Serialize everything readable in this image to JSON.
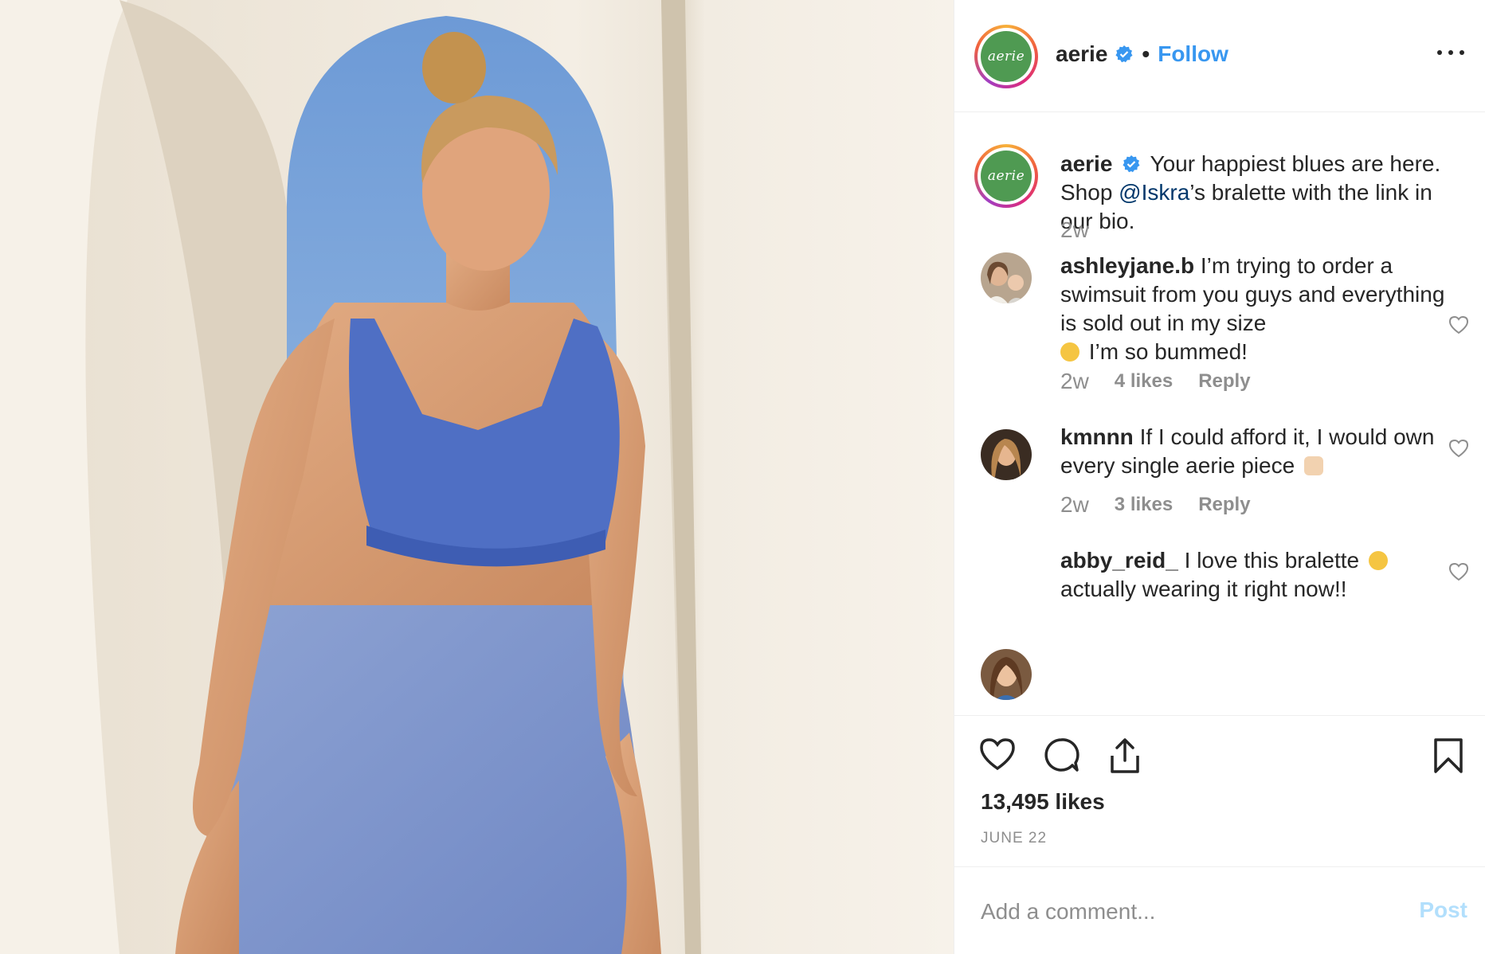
{
  "post": {
    "username": "aerie",
    "logo_text": "aerie",
    "follow_label": "Follow",
    "separator": "•",
    "caption": {
      "username": "aerie",
      "text_before": "Your happiest blues are here. Shop ",
      "mention": "@Iskra",
      "text_after": "’s bralette with the link in our bio.",
      "time": "2w"
    },
    "comments": [
      {
        "username": "ashleyjane.b",
        "text": "I’m trying to order a swimsuit from you guys and everything is sold out in my size",
        "text_end": "I’m so bummed!",
        "time": "2w",
        "likes": "4 likes",
        "reply": "Reply",
        "emoji": "crying-face"
      },
      {
        "username": "kmnnn",
        "text": "If I could afford it, I would own every single aerie piece",
        "time": "2w",
        "likes": "3 likes",
        "reply": "Reply",
        "emoji": "raised-hands"
      },
      {
        "username": "abby_reid_",
        "text": "I love this bralette",
        "text_end": "actually wearing it right now!!",
        "emoji": "star-struck"
      }
    ],
    "like_count": "13,495 likes",
    "date": "JUNE 22",
    "comment_placeholder": "Add a comment...",
    "post_label": "Post"
  },
  "colors": {
    "accent": "#3897f0",
    "verified": "#3897f0",
    "logo_green": "#4f9a52",
    "muted": "#8e8e8e",
    "post_disabled": "#b2dffc"
  }
}
